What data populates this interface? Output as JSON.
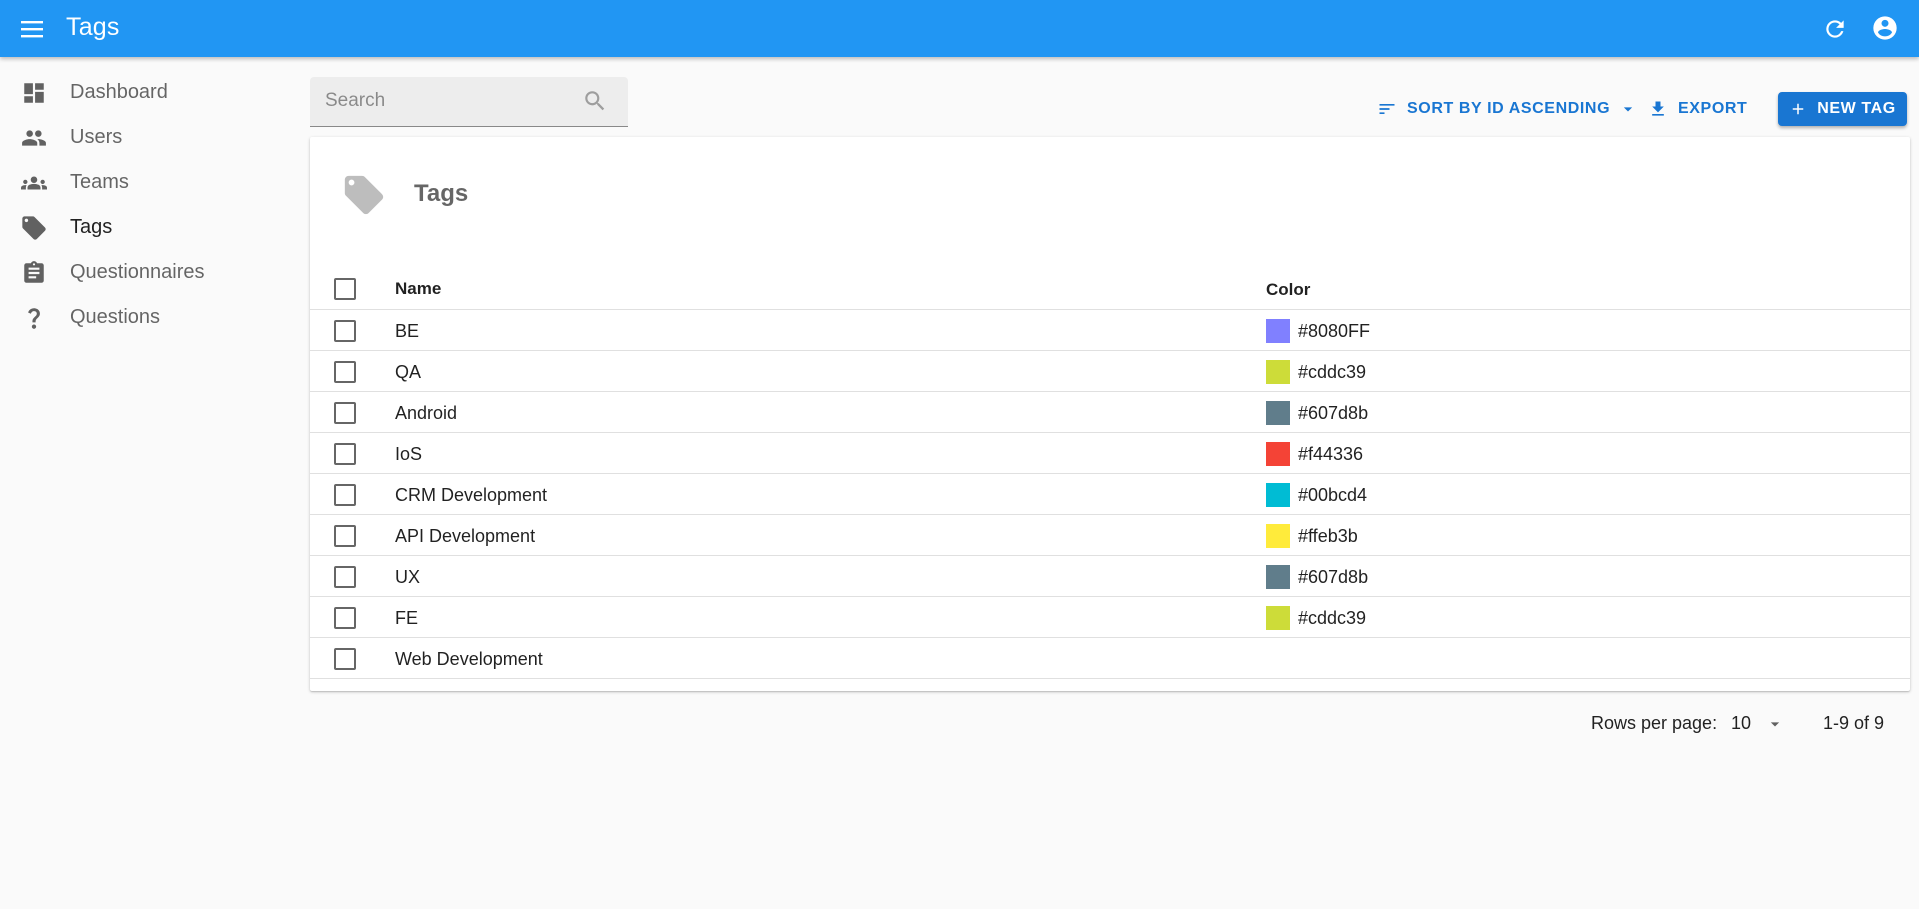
{
  "appbar": {
    "title": "Tags"
  },
  "sidebar": {
    "items": [
      {
        "label": "Dashboard",
        "icon": "dashboard-icon"
      },
      {
        "label": "Users",
        "icon": "users-icon"
      },
      {
        "label": "Teams",
        "icon": "teams-icon"
      },
      {
        "label": "Tags",
        "icon": "tag-icon",
        "active": true
      },
      {
        "label": "Questionnaires",
        "icon": "clipboard-icon"
      },
      {
        "label": "Questions",
        "icon": "question-icon"
      }
    ]
  },
  "search": {
    "placeholder": "Search",
    "value": ""
  },
  "toolbar": {
    "sort_label": "SORT BY ID ASCENDING",
    "export_label": "EXPORT",
    "new_label": "NEW TAG"
  },
  "card": {
    "title": "Tags"
  },
  "table": {
    "columns": {
      "name": "Name",
      "color": "Color"
    },
    "rows": [
      {
        "name": "BE",
        "color": "#8080FF"
      },
      {
        "name": "QA",
        "color": "#cddc39"
      },
      {
        "name": "Android",
        "color": "#607d8b"
      },
      {
        "name": "IoS",
        "color": "#f44336"
      },
      {
        "name": "CRM Development",
        "color": "#00bcd4"
      },
      {
        "name": "API Development",
        "color": "#ffeb3b"
      },
      {
        "name": "UX",
        "color": "#607d8b"
      },
      {
        "name": "FE",
        "color": "#cddc39"
      },
      {
        "name": "Web Development",
        "color": ""
      }
    ]
  },
  "pagination": {
    "rows_per_page_label": "Rows per page:",
    "rows_per_page": "10",
    "range": "1-9 of 9"
  },
  "colors": {
    "appbar": "#2196f3",
    "primary": "#1976d2"
  }
}
